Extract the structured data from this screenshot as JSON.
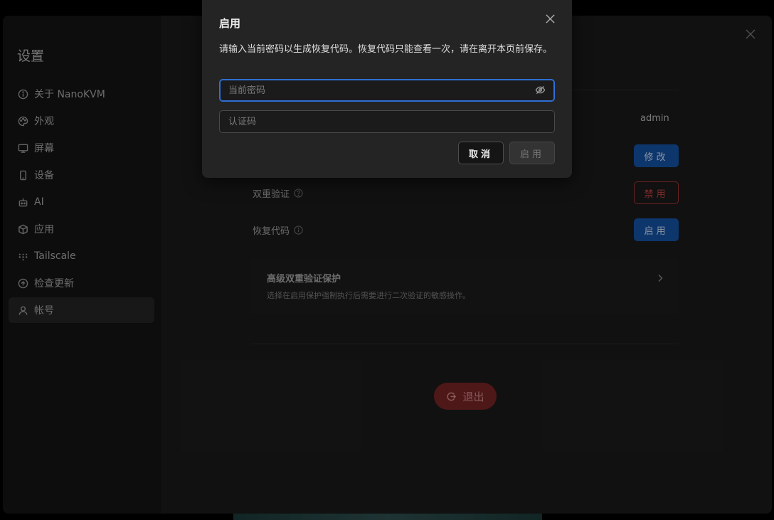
{
  "settings": {
    "title": "设置",
    "nav": [
      {
        "label": "关于 NanoKVM",
        "icon": "info-icon"
      },
      {
        "label": "外观",
        "icon": "palette-icon"
      },
      {
        "label": "屏幕",
        "icon": "monitor-icon"
      },
      {
        "label": "设备",
        "icon": "device-icon"
      },
      {
        "label": "AI",
        "icon": "robot-icon"
      },
      {
        "label": "应用",
        "icon": "package-icon"
      },
      {
        "label": "Tailscale",
        "icon": "tailscale-icon"
      },
      {
        "label": "检查更新",
        "icon": "update-icon"
      },
      {
        "label": "帐号",
        "icon": "user-icon",
        "active": true
      }
    ]
  },
  "account": {
    "username": "admin",
    "change_label": "修改",
    "two_factor": {
      "label": "双重验证",
      "action": "禁用"
    },
    "recovery_codes": {
      "label": "恢复代码",
      "action": "启用"
    },
    "advanced": {
      "title": "高级双重验证保护",
      "description": "选择在启用保护强制执行后需要进行二次验证的敏感操作。"
    },
    "logout_label": "退出"
  },
  "modal": {
    "title": "启用",
    "description": "请输入当前密码以生成恢复代码。恢复代码只能查看一次，请在离开本页前保存。",
    "password_placeholder": "当前密码",
    "code_placeholder": "认证码",
    "cancel_label": "取消",
    "enable_label": "启用"
  },
  "colors": {
    "primary": "#1554a8",
    "danger": "#c24343",
    "logout": "#7a2525",
    "focus": "#2f6fd6"
  }
}
